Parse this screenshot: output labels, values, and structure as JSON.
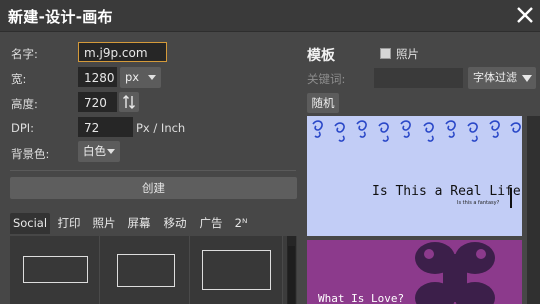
{
  "window": {
    "title": "新建-设计-画布"
  },
  "form": {
    "name_label": "名字:",
    "name_value": "m.j9p.com",
    "width_label": "宽:",
    "width_value": "1280",
    "unit_value": "px",
    "height_label": "高度:",
    "height_value": "720",
    "dpi_label": "DPI:",
    "dpi_value": "72",
    "dpi_unit": "Px / Inch",
    "bg_label": "背景色:",
    "bg_value": "白色"
  },
  "create_button": "创建",
  "tabs": [
    {
      "label": "Social"
    },
    {
      "label": "打印"
    },
    {
      "label": "照片"
    },
    {
      "label": "屏幕"
    },
    {
      "label": "移动"
    },
    {
      "label": "广告"
    },
    {
      "label": "2ᴺ"
    }
  ],
  "templates": {
    "title": "模板",
    "photo_label": "照片",
    "keyword_label": "关键词:",
    "filter_label": "字体过滤",
    "random_label": "随机",
    "cards": [
      {
        "title": "Is This a Real Life?",
        "subtitle": "Is this a fantasy?"
      },
      {
        "title": "What Is Love?"
      }
    ]
  },
  "colors": {
    "panel_bg": "#474747",
    "focus_border": "#d49a3a",
    "card1_bg": "#c2cdf6",
    "card1_swirl": "#2a48c8",
    "card2_bg": "#8c3a8c",
    "card2_flower": "#3c1f4a"
  },
  "icons": {
    "close": "close-icon",
    "swap": "swap-dimensions-icon",
    "dropdown": "chevron-down-icon"
  }
}
